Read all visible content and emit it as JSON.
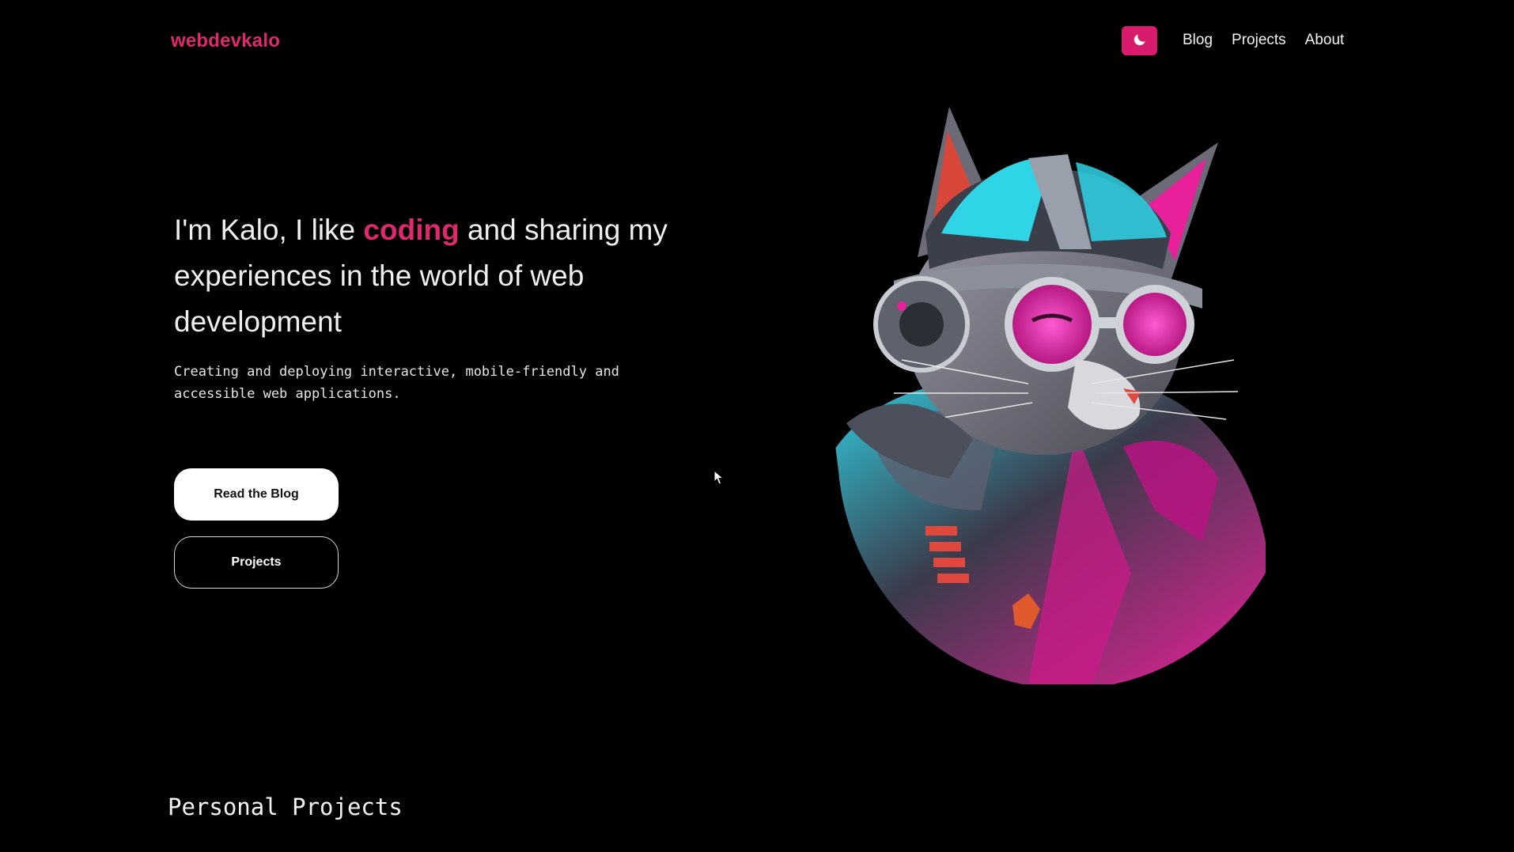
{
  "header": {
    "logo": "webdevkalo",
    "theme_toggle_icon": "moon-icon",
    "nav": [
      {
        "label": "Blog"
      },
      {
        "label": "Projects"
      },
      {
        "label": "About"
      }
    ]
  },
  "hero": {
    "title_part1": "I'm Kalo, I like ",
    "title_accent": "coding",
    "title_part2": " and sharing my experiences in the world of web development",
    "subtitle": "Creating and deploying interactive, mobile-friendly and accessible web applications.",
    "primary_button": "Read the Blog",
    "secondary_button": "Projects",
    "illustration": "cyberpunk-cat-illustration"
  },
  "sections": {
    "personal_projects_heading": "Personal Projects"
  },
  "colors": {
    "accent": "#e0286f",
    "toggle_bg": "#d81b6a",
    "background": "#000000",
    "cat_pink": "#e8209a",
    "cat_cyan": "#2fd4e6"
  }
}
